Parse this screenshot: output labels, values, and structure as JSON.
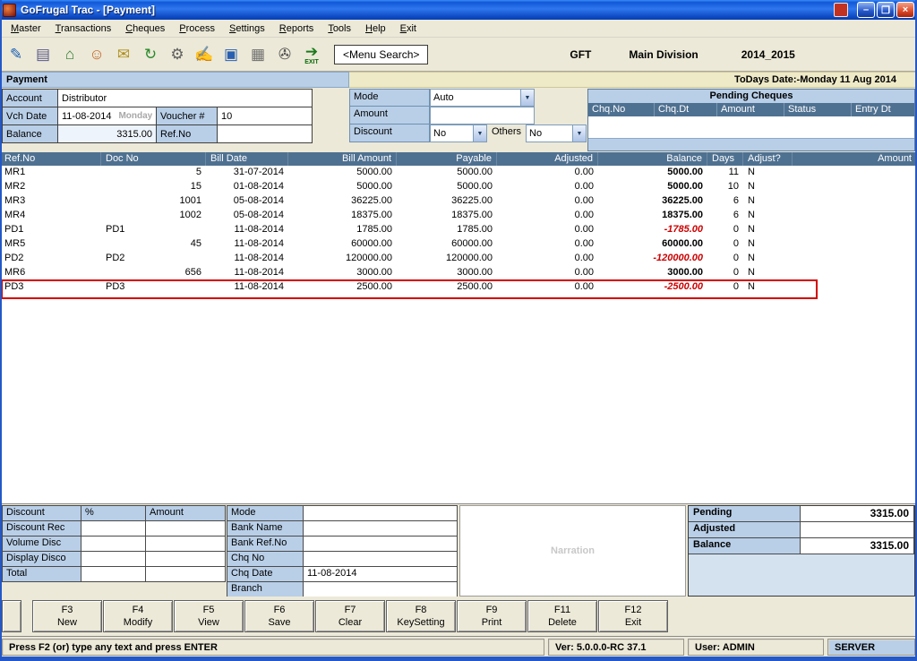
{
  "window": {
    "title": "GoFrugal Trac - [Payment]",
    "menu_items": [
      "Master",
      "Transactions",
      "Cheques",
      "Process",
      "Settings",
      "Reports",
      "Tools",
      "Help",
      "Exit"
    ],
    "controls": {
      "minimize": "–",
      "maximize": "❐",
      "close": "×"
    }
  },
  "toolbar": {
    "icons": [
      {
        "name": "new-voucher-icon",
        "glyph": "✎",
        "color": "#1a5fb4"
      },
      {
        "name": "save-icon",
        "glyph": "▤",
        "color": "#5a5a8a"
      },
      {
        "name": "company-icon",
        "glyph": "⌂",
        "color": "#2a7a2a"
      },
      {
        "name": "accounts-icon",
        "glyph": "☺",
        "color": "#c06020"
      },
      {
        "name": "cash-icon",
        "glyph": "✉",
        "color": "#b09020"
      },
      {
        "name": "refresh-icon",
        "glyph": "↻",
        "color": "#2a8a2a"
      },
      {
        "name": "settings-icon",
        "glyph": "⚙",
        "color": "#606060"
      },
      {
        "name": "edit-icon",
        "glyph": "✍",
        "color": "#2a7a4a"
      },
      {
        "name": "card-icon",
        "glyph": "▣",
        "color": "#2a5fb0"
      },
      {
        "name": "grid-icon",
        "glyph": "▦",
        "color": "#707070"
      },
      {
        "name": "print-icon",
        "glyph": "✇",
        "color": "#505050"
      },
      {
        "name": "exit-icon",
        "glyph": "➔",
        "color": "#1a7a1a",
        "label": "EXIT"
      }
    ],
    "menu_search_label": "<Menu Search>",
    "company": "GFT",
    "division": "Main Division",
    "financial_year": "2014_2015"
  },
  "payment_header": {
    "title": "Payment",
    "today_date": "ToDays Date:-Monday 11 Aug 2014"
  },
  "form": {
    "account_label": "Account",
    "account_value": "Distributor",
    "vch_date_label": "Vch Date",
    "vch_date_value": "11-08-2014",
    "vch_day": "Monday",
    "voucher_label": "Voucher #",
    "voucher_value": "10",
    "balance_label": "Balance",
    "balance_value": "3315.00",
    "refno_label": "Ref.No",
    "refno_value": "",
    "mode_label": "Mode",
    "mode_value": "Auto",
    "amount_label": "Amount",
    "amount_value": "",
    "discount_label": "Discount",
    "discount_value": "No",
    "others_label": "Others",
    "others_value": "No"
  },
  "pending_cheques": {
    "title": "Pending Cheques",
    "columns": [
      "Chq.No",
      "Chq.Dt",
      "Amount",
      "Status",
      "Entry Dt"
    ]
  },
  "bills": {
    "columns": [
      "Ref.No",
      "Doc No",
      "Bill Date",
      "Bill Amount",
      "Payable",
      "Adjusted",
      "Balance",
      "Days",
      "Adjust?",
      "Amount"
    ],
    "rows": [
      {
        "cells": [
          "MR1",
          "5",
          "31-07-2014",
          "5000.00",
          "5000.00",
          "0.00",
          "5000.00",
          "11",
          "N",
          ""
        ],
        "selected": false
      },
      {
        "cells": [
          "MR2",
          "15",
          "01-08-2014",
          "5000.00",
          "5000.00",
          "0.00",
          "5000.00",
          "10",
          "N",
          ""
        ],
        "selected": false
      },
      {
        "cells": [
          "MR3",
          "1001",
          "05-08-2014",
          "36225.00",
          "36225.00",
          "0.00",
          "36225.00",
          "6",
          "N",
          ""
        ],
        "selected": false
      },
      {
        "cells": [
          "MR4",
          "1002",
          "05-08-2014",
          "18375.00",
          "18375.00",
          "0.00",
          "18375.00",
          "6",
          "N",
          ""
        ],
        "selected": false
      },
      {
        "cells": [
          "PD1",
          "PD1",
          "11-08-2014",
          "1785.00",
          "1785.00",
          "0.00",
          "-1785.00",
          "0",
          "N",
          ""
        ],
        "selected": false
      },
      {
        "cells": [
          "MR5",
          "45",
          "11-08-2014",
          "60000.00",
          "60000.00",
          "0.00",
          "60000.00",
          "0",
          "N",
          ""
        ],
        "selected": false
      },
      {
        "cells": [
          "PD2",
          "PD2",
          "11-08-2014",
          "120000.00",
          "120000.00",
          "0.00",
          "-120000.00",
          "0",
          "N",
          ""
        ],
        "selected": false
      },
      {
        "cells": [
          "MR6",
          "656",
          "11-08-2014",
          "3000.00",
          "3000.00",
          "0.00",
          "3000.00",
          "0",
          "N",
          ""
        ],
        "selected": false
      },
      {
        "cells": [
          "PD3",
          "PD3",
          "11-08-2014",
          "2500.00",
          "2500.00",
          "0.00",
          "-2500.00",
          "0",
          "N",
          ""
        ],
        "selected": true
      }
    ]
  },
  "discount_panel": {
    "header": {
      "label": "Discount",
      "pct": "%",
      "amount": "Amount"
    },
    "rows": [
      {
        "label": "Discount Rec",
        "pct": "",
        "amount": ""
      },
      {
        "label": "Volume Disc",
        "pct": "",
        "amount": ""
      },
      {
        "label": "Display Disco",
        "pct": "",
        "amount": ""
      },
      {
        "label": "Total",
        "pct": "",
        "amount": ""
      }
    ]
  },
  "bank_panel": {
    "rows": [
      {
        "name": "mode",
        "label": "Mode",
        "value": ""
      },
      {
        "name": "bank-name",
        "label": "Bank Name",
        "value": ""
      },
      {
        "name": "bank-refno",
        "label": "Bank Ref.No",
        "value": ""
      },
      {
        "name": "chq-no",
        "label": "Chq No",
        "value": ""
      },
      {
        "name": "chq-date",
        "label": "Chq Date",
        "value": "11-08-2014"
      },
      {
        "name": "branch",
        "label": "Branch",
        "value": ""
      }
    ]
  },
  "narration": {
    "placeholder": "Narration"
  },
  "totals": {
    "rows": [
      {
        "label": "Pending",
        "value": "3315.00"
      },
      {
        "label": "Adjusted",
        "value": ""
      },
      {
        "label": "Balance",
        "value": "3315.00"
      }
    ]
  },
  "function_keys": [
    {
      "key": "F3",
      "label": "New"
    },
    {
      "key": "F4",
      "label": "Modify"
    },
    {
      "key": "F5",
      "label": "View"
    },
    {
      "key": "F6",
      "label": "Save"
    },
    {
      "key": "F7",
      "label": "Clear"
    },
    {
      "key": "F8",
      "label": "KeySetting"
    },
    {
      "key": "F9",
      "label": "Print"
    },
    {
      "key": "F11",
      "label": "Delete"
    },
    {
      "key": "F12",
      "label": "Exit"
    }
  ],
  "status_bar": {
    "message": "Press F2 (or) type any text and press ENTER",
    "version": "Ver: 5.0.0.0-RC 37.1",
    "user": "User: ADMIN",
    "server": "SERVER"
  },
  "colors": {
    "titlebar_blue": "#1157d8",
    "panel_blue": "#b9cfe8",
    "grid_header_slate": "#4f7191",
    "date_strip_khaki": "#eeeac8",
    "negative_red": "#cc0000",
    "selection_red": "#d40000",
    "taskbar_blue": "#2458c8"
  }
}
